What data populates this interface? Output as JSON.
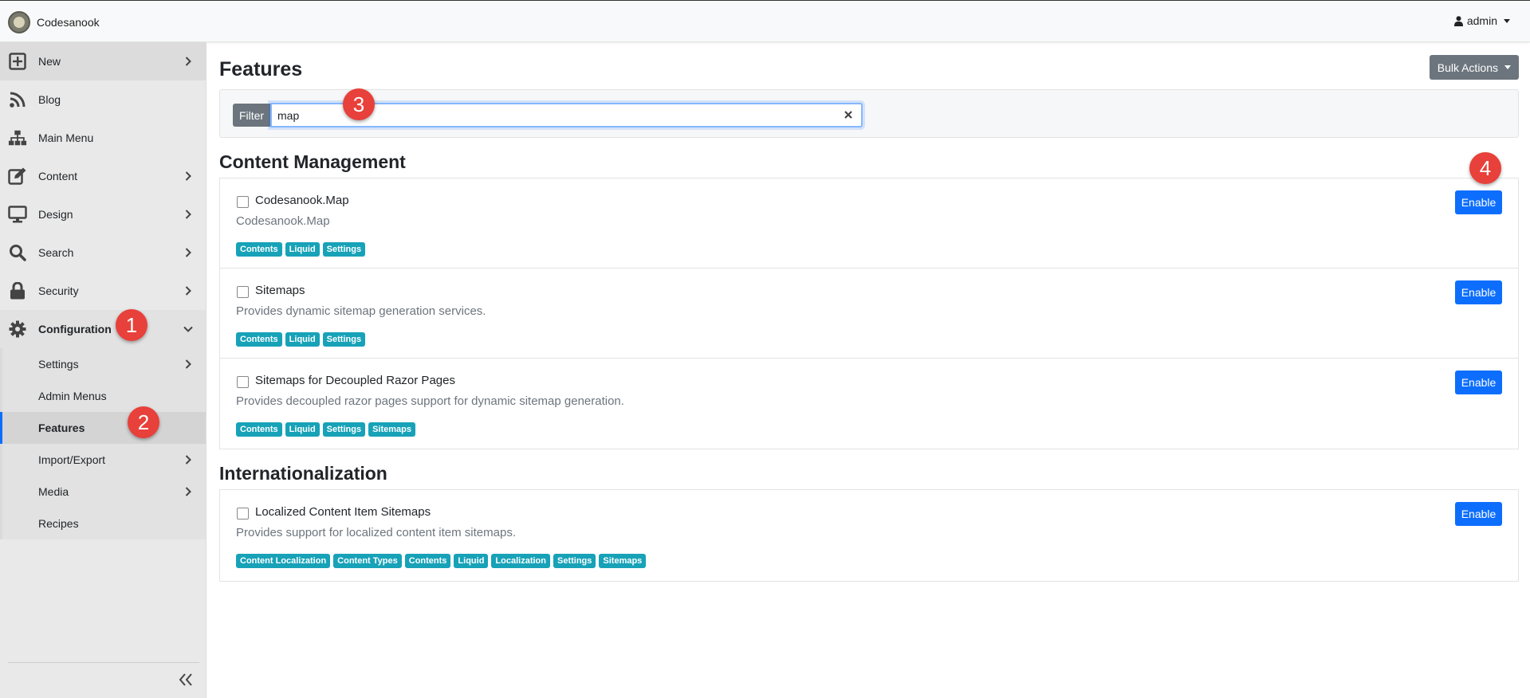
{
  "app": {
    "name": "Codesanook"
  },
  "user": {
    "name": "admin"
  },
  "sidebar": {
    "items": [
      {
        "label": "New",
        "icon": "plus-square-icon"
      },
      {
        "label": "Blog",
        "icon": "rss-icon"
      },
      {
        "label": "Main Menu",
        "icon": "sitemap-icon"
      },
      {
        "label": "Content",
        "icon": "edit-icon"
      },
      {
        "label": "Design",
        "icon": "desktop-icon"
      },
      {
        "label": "Search",
        "icon": "search-icon"
      },
      {
        "label": "Security",
        "icon": "lock-icon"
      },
      {
        "label": "Configuration",
        "icon": "gear-icon"
      }
    ],
    "config_sub": [
      {
        "label": "Settings"
      },
      {
        "label": "Admin Menus"
      },
      {
        "label": "Features"
      },
      {
        "label": "Import/Export"
      },
      {
        "label": "Media"
      },
      {
        "label": "Recipes"
      }
    ]
  },
  "markers": [
    "1",
    "2",
    "3",
    "4"
  ],
  "page": {
    "title": "Features",
    "bulk_actions": "Bulk Actions",
    "filter_label": "Filter",
    "filter_value": "map"
  },
  "sections": [
    {
      "title": "Content Management",
      "features": [
        {
          "name": "Codesanook.Map",
          "desc": "Codesanook.Map",
          "tags": [
            "Contents",
            "Liquid",
            "Settings"
          ],
          "button": "Enable"
        },
        {
          "name": "Sitemaps",
          "desc": "Provides dynamic sitemap generation services.",
          "tags": [
            "Contents",
            "Liquid",
            "Settings"
          ],
          "button": "Enable"
        },
        {
          "name": "Sitemaps for Decoupled Razor Pages",
          "desc": "Provides decoupled razor pages support for dynamic sitemap generation.",
          "tags": [
            "Contents",
            "Liquid",
            "Settings",
            "Sitemaps"
          ],
          "button": "Enable"
        }
      ]
    },
    {
      "title": "Internationalization",
      "features": [
        {
          "name": "Localized Content Item Sitemaps",
          "desc": "Provides support for localized content item sitemaps.",
          "tags": [
            "Content Localization",
            "Content Types",
            "Contents",
            "Liquid",
            "Localization",
            "Settings",
            "Sitemaps"
          ],
          "button": "Enable"
        }
      ]
    }
  ],
  "colors": {
    "primary": "#0d6efd",
    "tag": "#17a2b8",
    "secondary": "#6c757d",
    "marker": "#e8403a"
  }
}
